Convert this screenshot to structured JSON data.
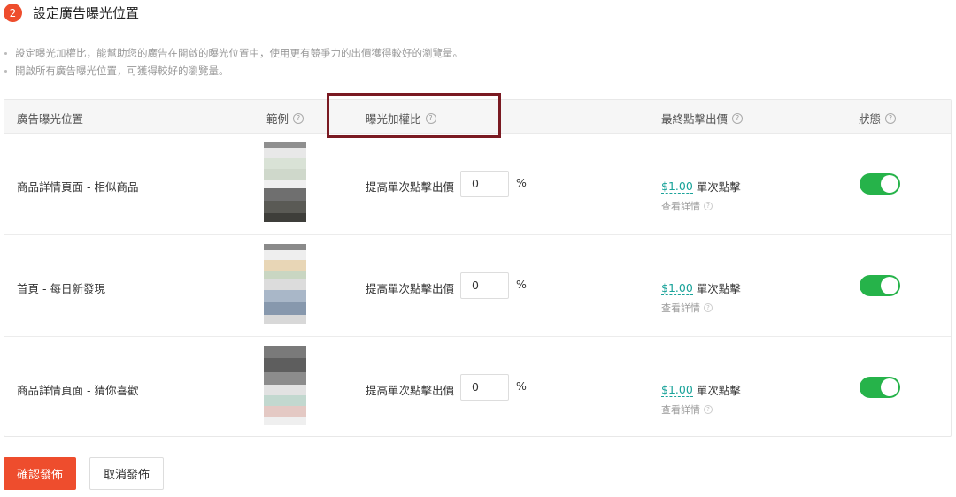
{
  "step": {
    "number": "2",
    "title": "設定廣告曝光位置"
  },
  "tips": [
    "設定曝光加權比，能幫助您的廣告在開啟的曝光位置中，使用更有競爭力的出價獲得較好的瀏覽量。",
    "開啟所有廣告曝光位置，可獲得較好的瀏覽量。"
  ],
  "table": {
    "headers": {
      "placement": "廣告曝光位置",
      "example": "範例",
      "weight": "曝光加權比",
      "final_bid": "最終點擊出價",
      "status": "狀態"
    },
    "help_glyph": "?",
    "rows": [
      {
        "placement": "商品詳情頁面 - 相似商品",
        "bid_label": "提高單次點擊出價",
        "bid_value": "0",
        "unit": "%",
        "price": "$1.00",
        "per_click": "單次點擊",
        "detail": "查看詳情",
        "status_on": true
      },
      {
        "placement": "首頁 - 每日新發現",
        "bid_label": "提高單次點擊出價",
        "bid_value": "0",
        "unit": "%",
        "price": "$1.00",
        "per_click": "單次點擊",
        "detail": "查看詳情",
        "status_on": true
      },
      {
        "placement": "商品詳情頁面 - 猜你喜歡",
        "bid_label": "提高單次點擊出價",
        "bid_value": "0",
        "unit": "%",
        "price": "$1.00",
        "per_click": "單次點擊",
        "detail": "查看詳情",
        "status_on": true
      }
    ]
  },
  "buttons": {
    "confirm": "確認發佈",
    "cancel": "取消發佈"
  },
  "colors": {
    "accent": "#ee4d2d",
    "toggle_on": "#26b34a",
    "price": "#1aa39a",
    "highlight_box": "#7a1a22"
  }
}
